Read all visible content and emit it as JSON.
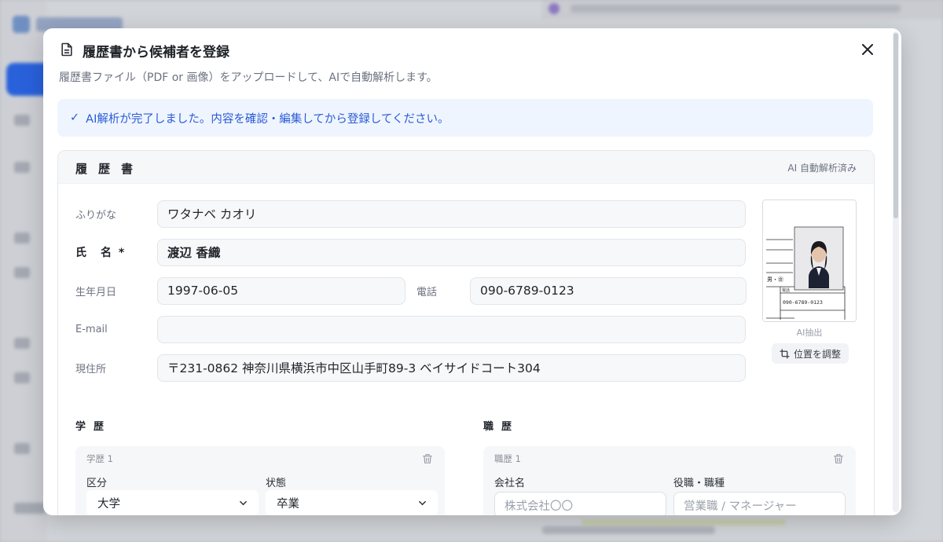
{
  "modal": {
    "title": "履歴書から候補者を登録",
    "subtitle": "履歴書ファイル（PDF or 画像）をアップロードして、AIで自動解析します。",
    "close_label": "×"
  },
  "alert": {
    "icon": "check-icon",
    "check": "✓",
    "text": "AI解析が完了しました。内容を確認・編集してから登録してください。",
    "color": "#2a5bd7"
  },
  "resume": {
    "title": "履歴書",
    "badge": "AI 自動解析済み",
    "furigana": {
      "label": "ふりがな",
      "value": "ワタナベ カオリ"
    },
    "name": {
      "label": "氏　名 *",
      "value": "渡辺 香織"
    },
    "birthdate": {
      "label": "生年月日",
      "value": "1997-06-05"
    },
    "phone": {
      "label": "電話",
      "value": "090-6789-0123"
    },
    "email": {
      "label": "E-mail",
      "value": ""
    },
    "address": {
      "label": "現住所",
      "value": "〒231-0862 神奈川県横浜市中区山手町89-3 ベイサイドコート304"
    },
    "photo": {
      "caption": "AI抽出",
      "adjust_label": "位置を調整",
      "thumb_gender": "男・㊛",
      "thumb_phone_label": "電話",
      "thumb_phone": "090-6789-0123"
    }
  },
  "education": {
    "title": "学歴",
    "entry": {
      "title": "学歴 1",
      "category_label": "区分",
      "category_value": "大学",
      "status_label": "状態",
      "status_value": "卒業"
    }
  },
  "career": {
    "title": "職歴",
    "entry": {
      "title": "職歴 1",
      "company_label": "会社名",
      "company_placeholder": "株式会社〇〇",
      "role_label": "役職・職種",
      "role_placeholder": "営業職 / マネージャー"
    }
  }
}
